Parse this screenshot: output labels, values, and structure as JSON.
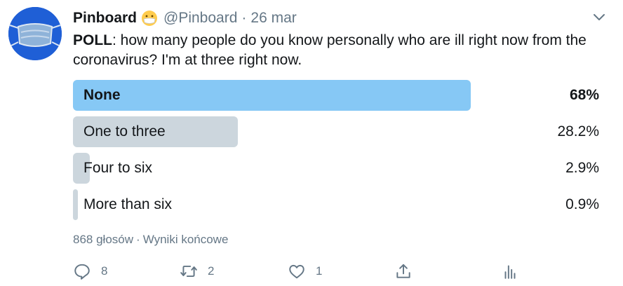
{
  "tweet": {
    "author_name": "Pinboard",
    "author_handle": "@Pinboard",
    "separator": "·",
    "date": "26 mar",
    "text_bold": "POLL",
    "text_rest": ": how many people do you know personally who are ill right now from the coronavirus? I'm at three right now.",
    "icons": {
      "avatar": "face-mask-avatar",
      "emoji": "mask-face-emoji",
      "menu": "chevron-down-icon"
    }
  },
  "poll": {
    "options": [
      {
        "label": "None",
        "percent_text": "68%",
        "fill": 0.68,
        "winner": true
      },
      {
        "label": "One to three",
        "percent_text": "28.2%",
        "fill": 0.282,
        "winner": false
      },
      {
        "label": "Four to six",
        "percent_text": "2.9%",
        "fill": 0.029,
        "winner": false
      },
      {
        "label": "More than six",
        "percent_text": "0.9%",
        "fill": 0.009,
        "winner": false
      }
    ],
    "votes": "868 głosów",
    "separator": "·",
    "status": "Wyniki końcowe",
    "colors": {
      "winner_bar": "#86c8f5",
      "other_bar": "#ccd6dd"
    }
  },
  "actions": {
    "reply_count": "8",
    "retweet_count": "2",
    "like_count": "1",
    "icons": [
      "reply-icon",
      "retweet-icon",
      "like-icon",
      "share-icon",
      "analytics-icon"
    ]
  }
}
